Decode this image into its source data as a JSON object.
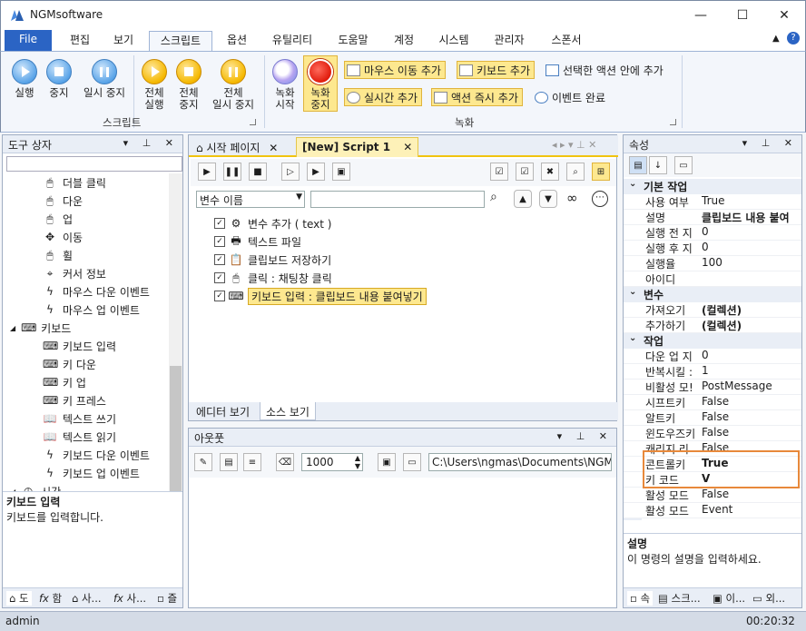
{
  "window": {
    "title": "NGMsoftware",
    "minimize": "—",
    "maximize": "☐",
    "close": "✕"
  },
  "ribbon_tabs": [
    "File",
    "편집",
    "보기",
    "스크립트",
    "옵션",
    "유틸리티",
    "도움말",
    "계정",
    "시스템",
    "관리자",
    "스폰서"
  ],
  "ribbon": {
    "script_group": {
      "label": "스크립트",
      "run": "실행",
      "stop": "중지",
      "pause": "일시 중지",
      "run_all_l1": "전체",
      "run_all_l2": "실행",
      "stop_all_l1": "전체",
      "stop_all_l2": "중지",
      "pause_all_l1": "전체",
      "pause_all_l2": "일시 중지"
    },
    "record_group": {
      "label": "녹화",
      "record_start_l1": "녹화",
      "record_start_l2": "시작",
      "record_stop_l1": "녹화",
      "record_stop_l2": "중지",
      "add_mouse_move": "마우스 이동 추가",
      "add_keyboard": "키보드 추가",
      "add_in_selected": "선택한 액션 안에 추가",
      "add_realtime": "실시간 추가",
      "add_action_now": "액션 즉시 추가",
      "event_done": "이벤트 완료"
    }
  },
  "toolbox": {
    "title": "도구 상자",
    "items": [
      {
        "icon": "🖱",
        "label": "더블 클릭",
        "indent": 2
      },
      {
        "icon": "🖱",
        "label": "다운",
        "indent": 2
      },
      {
        "icon": "🖱",
        "label": "업",
        "indent": 2
      },
      {
        "icon": "✥",
        "label": "이동",
        "indent": 2
      },
      {
        "icon": "🖱",
        "label": "휠",
        "indent": 2
      },
      {
        "icon": "⌖",
        "label": "커서 정보",
        "indent": 2
      },
      {
        "icon": "ϟ",
        "label": "마우스 다운 이벤트",
        "indent": 2
      },
      {
        "icon": "ϟ",
        "label": "마우스 업 이벤트",
        "indent": 2
      },
      {
        "icon": "⌨",
        "label": "키보드",
        "indent": 1
      },
      {
        "icon": "⌨",
        "label": "키보드 입력",
        "indent": 2
      },
      {
        "icon": "⌨",
        "label": "키 다운",
        "indent": 2
      },
      {
        "icon": "⌨",
        "label": "키 업",
        "indent": 2
      },
      {
        "icon": "⌨",
        "label": "키 프레스",
        "indent": 2
      },
      {
        "icon": "📖",
        "label": "텍스트 쓰기",
        "indent": 2
      },
      {
        "icon": "📖",
        "label": "텍스트 읽기",
        "indent": 2
      },
      {
        "icon": "ϟ",
        "label": "키보드 다운 이벤트",
        "indent": 2
      },
      {
        "icon": "ϟ",
        "label": "키보드 업 이벤트",
        "indent": 2
      },
      {
        "icon": "◷",
        "label": "시간",
        "indent": 1
      }
    ],
    "desc_title": "키보드 입력",
    "desc_text": "키보드를 입력합니다.",
    "bottom_tabs": [
      "도",
      "함",
      "사...",
      "사...",
      "즐"
    ]
  },
  "editor": {
    "tabs": [
      "시작 페이지",
      "[New] Script 1"
    ],
    "var_select": "변수 이름",
    "rows": [
      {
        "label": "변수 추가 ( text )",
        "icon": "⚙",
        "selected": false
      },
      {
        "label": "텍스트 파일",
        "icon": "🖶",
        "selected": false
      },
      {
        "label": "클립보드 저장하기",
        "icon": "📋",
        "selected": false
      },
      {
        "label": "클릭 : 채팅창 클릭",
        "icon": "🖱",
        "selected": false
      },
      {
        "label": "키보드 입력 : 클립보드 내용 붙여넣기",
        "icon": "⌨",
        "selected": true
      }
    ],
    "view_tabs": [
      "에디터 보기",
      "소스 보기"
    ]
  },
  "output": {
    "title": "아웃풋",
    "interval": "1000",
    "path": "C:\\Users\\ngmas\\Documents\\NGM6\\"
  },
  "properties": {
    "title": "속성",
    "sections": [
      {
        "name": "기본 작업",
        "rows": [
          {
            "k": "사용 여부",
            "v": "True",
            "bold": false
          },
          {
            "k": "설명",
            "v": "클립보드 내용 붙여",
            "bold": true
          },
          {
            "k": "실행 전 지",
            "v": "0",
            "bold": false
          },
          {
            "k": "실행 후 지",
            "v": "0",
            "bold": false
          },
          {
            "k": "실행율",
            "v": "100",
            "bold": false
          },
          {
            "k": "아이디",
            "v": "",
            "bold": false
          }
        ]
      },
      {
        "name": "변수",
        "rows": [
          {
            "k": "가져오기",
            "v": "(컬렉션)",
            "bold": true
          },
          {
            "k": "추가하기",
            "v": "(컬렉션)",
            "bold": true
          }
        ]
      },
      {
        "name": "작업",
        "rows": [
          {
            "k": "다운 업 지",
            "v": "0",
            "bold": false
          },
          {
            "k": "반복시킬 :",
            "v": "1",
            "bold": false
          },
          {
            "k": "비활성 모!",
            "v": "PostMessage",
            "bold": false
          },
          {
            "k": "시프트키",
            "v": "False",
            "bold": false
          },
          {
            "k": "알트키",
            "v": "False",
            "bold": false
          },
          {
            "k": "윈도우즈키",
            "v": "False",
            "bold": false
          },
          {
            "k": "캐리지 리",
            "v": "False",
            "bold": false
          },
          {
            "k": "콘트롤키",
            "v": "True",
            "bold": true
          },
          {
            "k": "키 코드",
            "v": "V",
            "bold": true
          },
          {
            "k": "활성 모드",
            "v": "False",
            "bold": false
          },
          {
            "k": "활성 모드",
            "v": "Event",
            "bold": false
          }
        ]
      }
    ],
    "desc_title": "설명",
    "desc_text": "이 명령의 설명을 입력하세요.",
    "bottom_tabs": [
      "속",
      "스크...",
      "이...",
      "외..."
    ]
  },
  "status": {
    "user": "admin",
    "time": "00:20:32"
  },
  "colors": {
    "accent": "#2b64c4",
    "highlight": "#fde88f",
    "prop_highlight": "#e8893b"
  }
}
